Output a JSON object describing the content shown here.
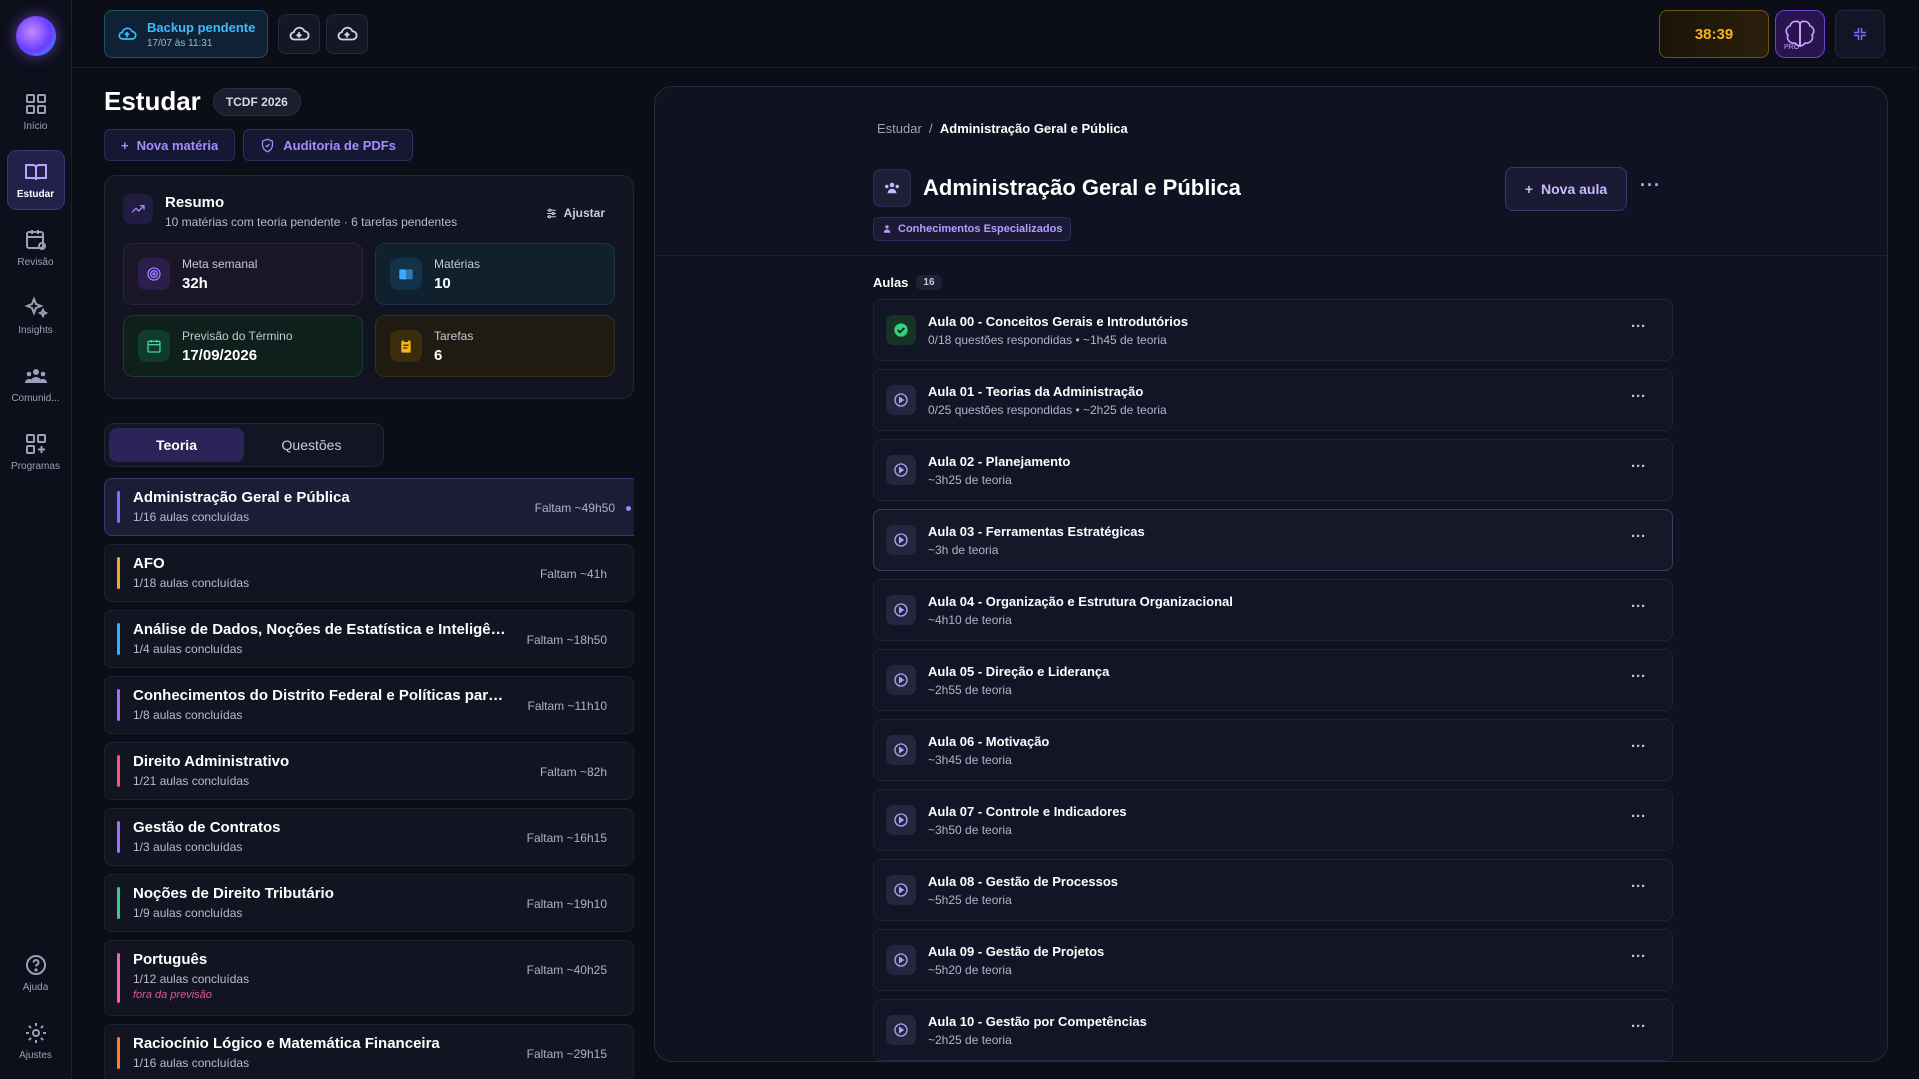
{
  "rail": {
    "items": [
      {
        "label": "Início",
        "icon": "grid-icon"
      },
      {
        "label": "Estudar",
        "icon": "book-icon",
        "active": true
      },
      {
        "label": "Revisão",
        "icon": "calendar-refresh-icon"
      },
      {
        "label": "Insights",
        "icon": "sparkles-icon"
      },
      {
        "label": "Comunid...",
        "icon": "users-icon"
      },
      {
        "label": "Programas",
        "icon": "grid-plus-icon"
      }
    ],
    "bottom": [
      {
        "label": "Ajuda",
        "icon": "help-icon"
      },
      {
        "label": "Ajustes",
        "icon": "gear-icon"
      }
    ]
  },
  "topbar": {
    "backup_title": "Backup pendente",
    "backup_time": "17/07 às 11:31",
    "timer": "38:39",
    "pro_label": "PRO"
  },
  "page": {
    "title": "Estudar",
    "exam_tag": "TCDF 2026",
    "nova_materia": "Nova matéria",
    "auditoria": "Auditoria de PDFs"
  },
  "summary": {
    "title": "Resumo",
    "subtitle": "10 matérias com teoria pendente · 6 tarefas pendentes",
    "ajustar": "Ajustar",
    "stats": [
      {
        "label": "Meta semanal",
        "value": "32h"
      },
      {
        "label": "Matérias",
        "value": "10"
      },
      {
        "label": "Previsão do Término",
        "value": "17/09/2026"
      },
      {
        "label": "Tarefas",
        "value": "6"
      }
    ]
  },
  "tabs": {
    "teoria": "Teoria",
    "questoes": "Questões"
  },
  "subjects": [
    {
      "name": "Administração Geral e Pública",
      "progress": "1/16 aulas concluídas",
      "remaining": "Faltam ~49h50",
      "color": "#8b6bff"
    },
    {
      "name": "AFO",
      "progress": "1/18 aulas concluídas",
      "remaining": "Faltam ~41h",
      "color": "#f5a623"
    },
    {
      "name": "Análise de Dados, Noções de Estatística e Inteligência Artificial",
      "progress": "1/4 aulas concluídas",
      "remaining": "Faltam ~18h50",
      "color": "#3fa9ff"
    },
    {
      "name": "Conhecimentos do Distrito Federal e Políticas para as Mulheres",
      "progress": "1/8 aulas concluídas",
      "remaining": "Faltam ~11h10",
      "color": "#a070ff"
    },
    {
      "name": "Direito Administrativo",
      "progress": "1/21 aulas concluídas",
      "remaining": "Faltam ~82h",
      "color": "#ff4f7b"
    },
    {
      "name": "Gestão de Contratos",
      "progress": "1/3 aulas concluídas",
      "remaining": "Faltam ~16h15",
      "color": "#a070ff"
    },
    {
      "name": "Noções de Direito Tributário",
      "progress": "1/9 aulas concluídas",
      "remaining": "Faltam ~19h10",
      "color": "#2fd37e"
    },
    {
      "name": "Português",
      "progress": "1/12 aulas concluídas",
      "remaining": "Faltam ~40h25",
      "note": "fora da previsão",
      "color": "#ff5fa0"
    },
    {
      "name": "Raciocínio Lógico e Matemática Financeira",
      "progress": "1/16 aulas concluídas",
      "remaining": "Faltam ~29h15",
      "color": "#ff7a2f"
    }
  ],
  "detail": {
    "breadcrumb_root": "Estudar",
    "breadcrumb_sep": "/",
    "breadcrumb_current": "Administração Geral e Pública",
    "title": "Administração Geral e Pública",
    "category": "Conhecimentos Especializados",
    "nova_aula": "Nova aula",
    "aulas_label": "Aulas",
    "aulas_count": "16",
    "lessons": [
      {
        "title": "Aula 00 - Conceitos Gerais e Introdutórios",
        "sub": "0/18 questões respondidas  •  ~1h45 de teoria",
        "done": true
      },
      {
        "title": "Aula 01 - Teorias da Administração",
        "sub": "0/25 questões respondidas  •  ~2h25 de teoria"
      },
      {
        "title": "Aula 02 - Planejamento",
        "sub": "~3h25 de teoria"
      },
      {
        "title": "Aula 03 - Ferramentas Estratégicas",
        "sub": "~3h de teoria",
        "highlight": true
      },
      {
        "title": "Aula 04 - Organização e Estrutura Organizacional",
        "sub": "~4h10 de teoria"
      },
      {
        "title": "Aula 05 - Direção e Liderança",
        "sub": "~2h55 de teoria"
      },
      {
        "title": "Aula 06 - Motivação",
        "sub": "~3h45 de teoria"
      },
      {
        "title": "Aula 07 - Controle e Indicadores",
        "sub": "~3h50 de teoria"
      },
      {
        "title": "Aula 08 - Gestão de Processos",
        "sub": "~5h25 de teoria"
      },
      {
        "title": "Aula 09 - Gestão de Projetos",
        "sub": "~5h20 de teoria"
      },
      {
        "title": "Aula 10 - Gestão por Competências",
        "sub": "~2h25 de teoria"
      }
    ]
  }
}
